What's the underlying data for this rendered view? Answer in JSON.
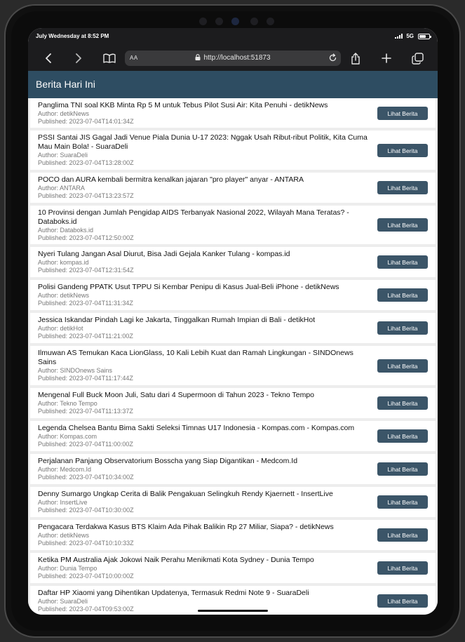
{
  "status_bar": {
    "time": "July Wednesday at 8:52 PM",
    "network": "5G"
  },
  "browser": {
    "aa_label": "AA",
    "url": "http://localhost:51873"
  },
  "app": {
    "title": "Berita Hari Ini"
  },
  "button_label": "Lihat Berita",
  "articles": [
    {
      "title": "Panglima TNI soal KKB Minta Rp 5 M untuk Tebus Pilot Susi Air: Kita Penuhi - detikNews",
      "author": "Author: detikNews",
      "published": "Published: 2023-07-04T14:01:34Z"
    },
    {
      "title": "PSSI Santai JIS Gagal Jadi Venue Piala Dunia U-17 2023: Nggak Usah Ribut-ribut Politik, Kita Cuma Mau Main Bola! - SuaraDeli",
      "author": "Author: SuaraDeli",
      "published": "Published: 2023-07-04T13:28:00Z"
    },
    {
      "title": "POCO dan AURA kembali bermitra kenalkan jajaran \"pro player\" anyar - ANTARA",
      "author": "Author: ANTARA",
      "published": "Published: 2023-07-04T13:23:57Z"
    },
    {
      "title": "10 Provinsi dengan Jumlah Pengidap AIDS Terbanyak Nasional 2022, Wilayah Mana Teratas? - Databoks.id",
      "author": "Author: Databoks.id",
      "published": "Published: 2023-07-04T12:50:00Z"
    },
    {
      "title": "Nyeri Tulang Jangan Asal Diurut, Bisa Jadi Gejala Kanker Tulang - kompas.id",
      "author": "Author: kompas.id",
      "published": "Published: 2023-07-04T12:31:54Z"
    },
    {
      "title": "Polisi Gandeng PPATK Usut TPPU Si Kembar Penipu di Kasus Jual-Beli iPhone - detikNews",
      "author": "Author: detikNews",
      "published": "Published: 2023-07-04T11:31:34Z"
    },
    {
      "title": "Jessica Iskandar Pindah Lagi ke Jakarta, Tinggalkan Rumah Impian di Bali - detikHot",
      "author": "Author: detikHot",
      "published": "Published: 2023-07-04T11:21:00Z"
    },
    {
      "title": "Ilmuwan AS Temukan Kaca LionGlass, 10 Kali Lebih Kuat dan Ramah Lingkungan - SINDOnews Sains",
      "author": "Author: SINDOnews Sains",
      "published": "Published: 2023-07-04T11:17:44Z"
    },
    {
      "title": "Mengenal Full Buck Moon Juli, Satu dari 4 Supermoon di Tahun 2023 - Tekno Tempo",
      "author": "Author: Tekno Tempo",
      "published": "Published: 2023-07-04T11:13:37Z"
    },
    {
      "title": "Legenda Chelsea Bantu Bima Sakti Seleksi Timnas U17 Indonesia - Kompas.com - Kompas.com",
      "author": "Author: Kompas.com",
      "published": "Published: 2023-07-04T11:00:00Z"
    },
    {
      "title": "Perjalanan Panjang Observatorium Bosscha yang Siap Digantikan - Medcom.Id",
      "author": "Author: Medcom.Id",
      "published": "Published: 2023-07-04T10:34:00Z"
    },
    {
      "title": "Denny Sumargo Ungkap Cerita di Balik Pengakuan Selingkuh Rendy Kjaernett - InsertLive",
      "author": "Author: InsertLive",
      "published": "Published: 2023-07-04T10:30:00Z"
    },
    {
      "title": "Pengacara Terdakwa Kasus BTS Klaim Ada Pihak Balikin Rp 27 Miliar, Siapa? - detikNews",
      "author": "Author: detikNews",
      "published": "Published: 2023-07-04T10:10:33Z"
    },
    {
      "title": "Ketika PM Australia Ajak Jokowi Naik Perahu Menikmati Kota Sydney - Dunia Tempo",
      "author": "Author: Dunia Tempo",
      "published": "Published: 2023-07-04T10:00:00Z"
    },
    {
      "title": "Daftar HP Xiaomi yang Dihentikan Updatenya, Termasuk Redmi Note 9 - SuaraDeli",
      "author": "Author: SuaraDeli",
      "published": "Published: 2023-07-04T09:53:00Z"
    }
  ]
}
